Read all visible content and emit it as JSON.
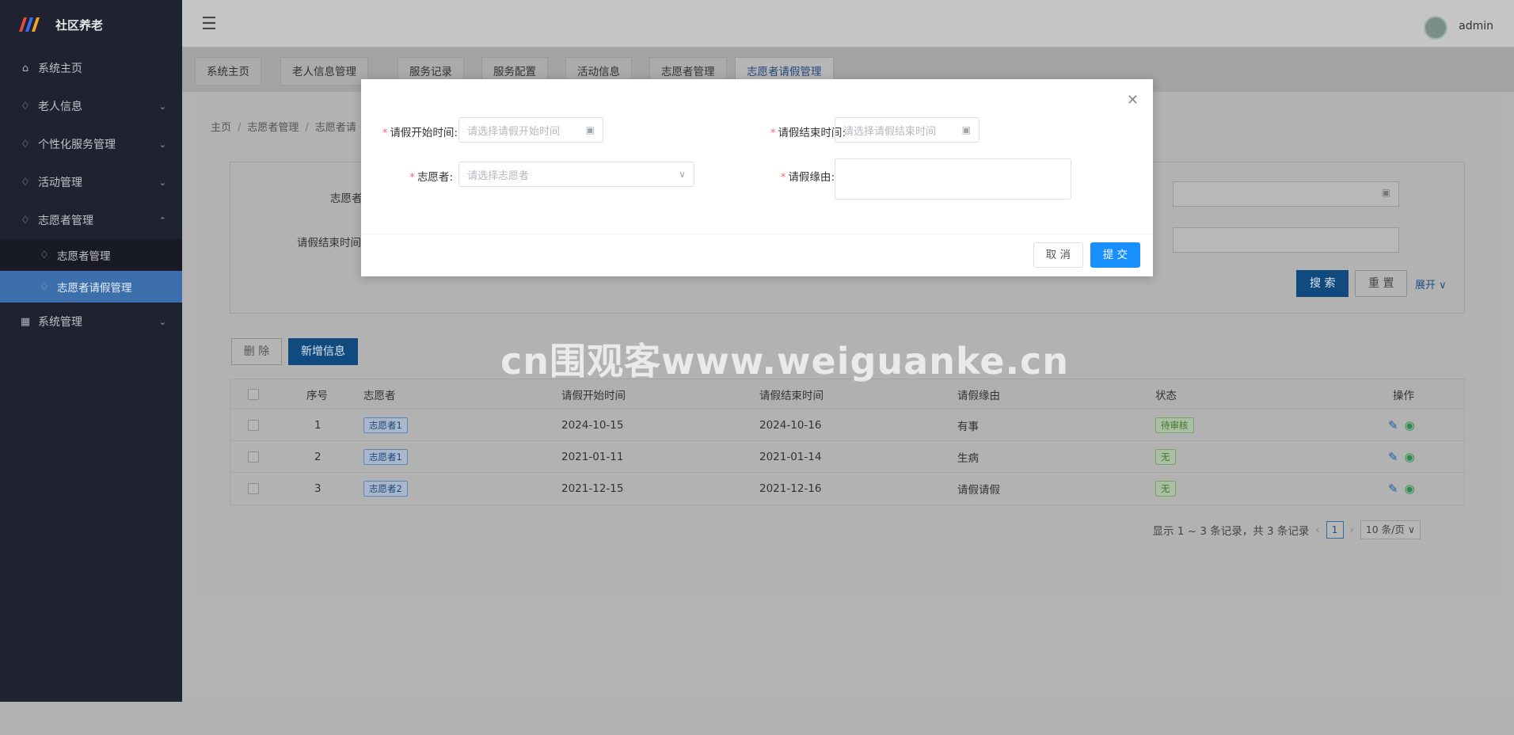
{
  "app": {
    "title": "社区养老",
    "user": "admin"
  },
  "sidebar": {
    "items": [
      {
        "label": "系统主页",
        "icon": "home-icon"
      },
      {
        "label": "老人信息",
        "icon": "flame-icon"
      },
      {
        "label": "个性化服务管理",
        "icon": "flame-icon"
      },
      {
        "label": "活动管理",
        "icon": "flame-icon"
      },
      {
        "label": "志愿者管理",
        "icon": "flame-icon"
      },
      {
        "label": "系统管理",
        "icon": "grid-icon"
      }
    ],
    "sub_items": [
      "志愿者管理",
      "志愿者请假管理"
    ]
  },
  "tabs": [
    "系统主页",
    "老人信息管理",
    "服务记录",
    "服务配置",
    "活动信息",
    "志愿者管理",
    "志愿者请假管理"
  ],
  "breadcrumb": [
    "主页",
    "志愿者管理",
    "志愿者请"
  ],
  "search": {
    "label_volunteer": "志愿者",
    "label_end": "请假结束时间",
    "search_btn": "搜 索",
    "reset_btn": "重 置",
    "expand": "展开"
  },
  "actions": {
    "delete": "删 除",
    "add": "新增信息"
  },
  "watermark": "cn围观客www.weiguanke.cn",
  "table": {
    "headers": [
      "序号",
      "志愿者",
      "请假开始时间",
      "请假结束时间",
      "请假缘由",
      "状态",
      "操作"
    ],
    "rows": [
      {
        "no": "1",
        "volunteer": "志愿者1",
        "start": "2024-10-15",
        "end": "2024-10-16",
        "reason": "有事",
        "status": "待审核"
      },
      {
        "no": "2",
        "volunteer": "志愿者1",
        "start": "2021-01-11",
        "end": "2021-01-14",
        "reason": "生病",
        "status": "无"
      },
      {
        "no": "3",
        "volunteer": "志愿者2",
        "start": "2021-12-15",
        "end": "2021-12-16",
        "reason": "请假请假",
        "status": "无"
      }
    ]
  },
  "pagination": {
    "summary": "显示 1 ~ 3 条记录，共 3 条记录",
    "page": "1",
    "page_size": "10 条/页"
  },
  "modal": {
    "label_start": "请假开始时间",
    "placeholder_start": "请选择请假开始时间",
    "label_end": "请假结束时间",
    "placeholder_end": "请选择请假结束时间",
    "label_volunteer": "志愿者",
    "placeholder_volunteer": "请选择志愿者",
    "label_reason": "请假缘由",
    "cancel": "取 消",
    "submit": "提 交"
  }
}
